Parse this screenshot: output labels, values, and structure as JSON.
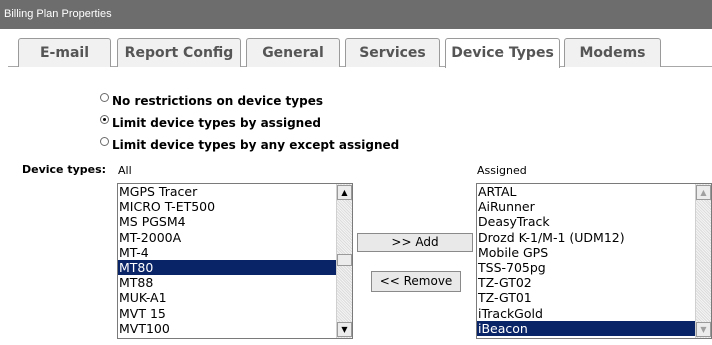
{
  "window": {
    "title": "Billing Plan Properties"
  },
  "tabs": [
    {
      "label": "E-mail"
    },
    {
      "label": "Report Config"
    },
    {
      "label": "General"
    },
    {
      "label": "Services"
    },
    {
      "label": "Device Types"
    },
    {
      "label": "Modems"
    }
  ],
  "active_tab": "Device Types",
  "restriction_options": [
    {
      "label": "No restrictions on device types",
      "checked": false
    },
    {
      "label": "Limit device types by assigned",
      "checked": true
    },
    {
      "label": "Limit device types by any except assigned",
      "checked": false
    }
  ],
  "device_types": {
    "label": "Device types:",
    "all_label": "All",
    "assigned_label": "Assigned",
    "all_items": [
      "MGPS Tracer",
      "MICRO T-ET500",
      "MS PGSM4",
      "MT-2000A",
      "MT-4",
      "MT80",
      "MT88",
      "MUK-A1",
      "MVT 15",
      "MVT100"
    ],
    "all_selected": "MT80",
    "assigned_items": [
      "ARTAL",
      "AiRunner",
      "DeasyTrack",
      "Drozd K-1/M-1 (UDM12)",
      "Mobile GPS",
      "TSS-705pg",
      "TZ-GT02",
      "TZ-GT01",
      "iTrackGold",
      "iBeacon"
    ],
    "assigned_selected": "iBeacon",
    "add_button": ">> Add",
    "remove_button": "<< Remove"
  },
  "icons": {
    "scroll_up": "scroll-up-arrow-icon",
    "scroll_down": "scroll-down-arrow-icon"
  },
  "colors": {
    "titlebar": "#6d6d6d",
    "selection": "#0a2468"
  }
}
